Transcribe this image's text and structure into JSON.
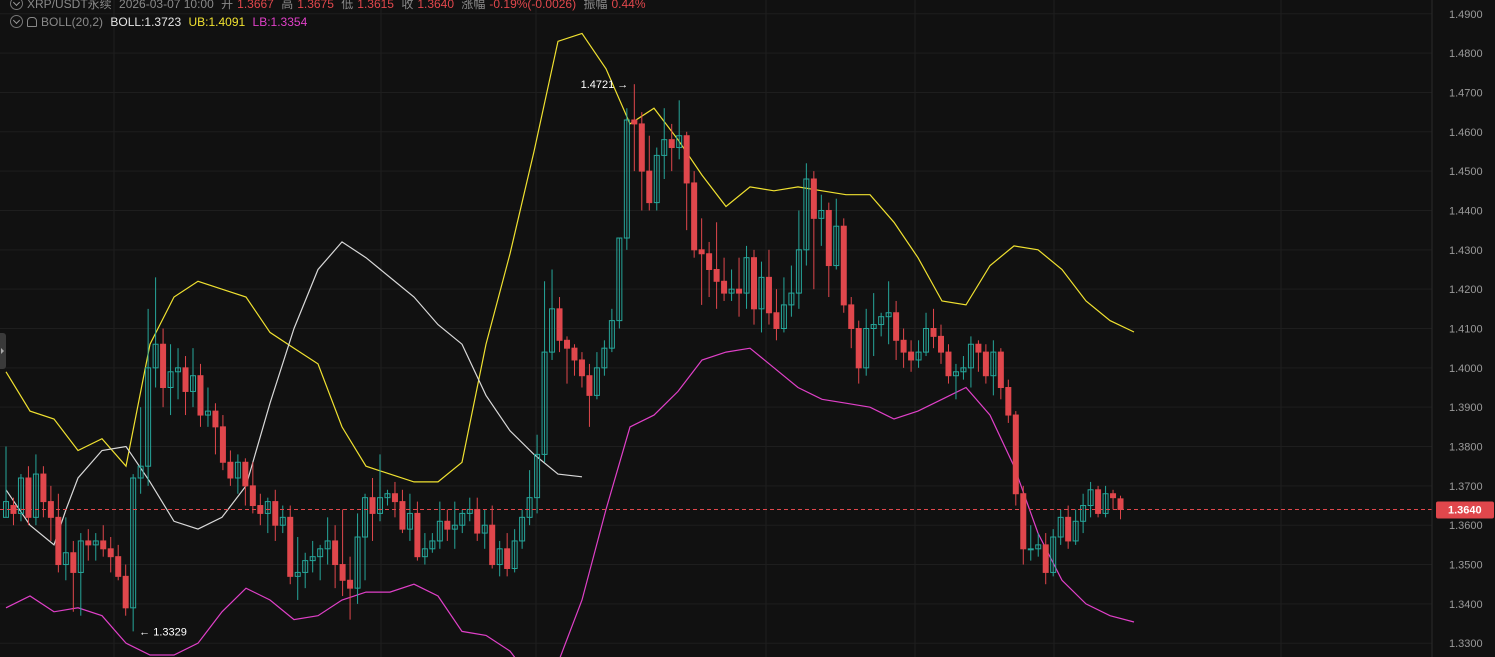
{
  "header": {
    "symbol": "XRP/USDT永续",
    "datetime": "2026-03-07 10:00",
    "open_label": "开",
    "open": "1.3667",
    "high_label": "高",
    "high": "1.3675",
    "low_label": "低",
    "low": "1.3615",
    "close_label": "收",
    "close": "1.3640",
    "change_label": "涨幅",
    "change": "-0.19%(-0.0026)",
    "amplitude_label": "振幅",
    "amplitude": "0.44%"
  },
  "indicator": {
    "name": "BOLL(20,2)",
    "boll": "BOLL:1.3723",
    "ub": "UB:1.4091",
    "lb": "LB:1.3354"
  },
  "colors": {
    "background": "#111111",
    "up": "#26a69a",
    "down": "#e0474c",
    "mid_band": "#d9d9d9",
    "upper_band": "#f0e130",
    "lower_band": "#e040c8",
    "grid": "#1e1e1e"
  },
  "chart_data": {
    "type": "candlestick",
    "y_range": [
      1.3265,
      1.4935
    ],
    "y_ticks": [
      "1.3300",
      "1.3400",
      "1.3500",
      "1.3600",
      "1.3700",
      "1.3800",
      "1.3900",
      "1.4000",
      "1.4100",
      "1.4200",
      "1.4300",
      "1.4400",
      "1.4500",
      "1.4600",
      "1.4700",
      "1.4800",
      "1.4900"
    ],
    "last_price": "1.3640",
    "max_label": "1.4721",
    "min_label": "1.3329",
    "candles": [
      [
        1.362,
        1.366,
        1.38,
        1.362
      ],
      [
        1.365,
        1.363,
        1.367,
        1.36
      ],
      [
        1.363,
        1.372,
        1.373,
        1.361
      ],
      [
        1.372,
        1.362,
        1.375,
        1.36
      ],
      [
        1.362,
        1.373,
        1.378,
        1.36
      ],
      [
        1.373,
        1.366,
        1.375,
        1.362
      ],
      [
        1.366,
        1.362,
        1.37,
        1.356
      ],
      [
        1.362,
        1.35,
        1.368,
        1.348
      ],
      [
        1.35,
        1.353,
        1.362,
        1.346
      ],
      [
        1.353,
        1.348,
        1.356,
        1.338
      ],
      [
        1.348,
        1.356,
        1.358,
        1.337
      ],
      [
        1.356,
        1.355,
        1.359,
        1.351
      ],
      [
        1.355,
        1.356,
        1.358,
        1.351
      ],
      [
        1.356,
        1.354,
        1.36,
        1.352
      ],
      [
        1.354,
        1.352,
        1.357,
        1.348
      ],
      [
        1.352,
        1.347,
        1.355,
        1.346
      ],
      [
        1.347,
        1.339,
        1.35,
        1.337
      ],
      [
        1.339,
        1.372,
        1.373,
        1.333
      ],
      [
        1.372,
        1.375,
        1.39,
        1.368
      ],
      [
        1.375,
        1.4,
        1.415,
        1.37
      ],
      [
        1.4,
        1.406,
        1.423,
        1.395
      ],
      [
        1.406,
        1.395,
        1.41,
        1.39
      ],
      [
        1.395,
        1.399,
        1.406,
        1.388
      ],
      [
        1.399,
        1.4,
        1.405,
        1.392
      ],
      [
        1.4,
        1.394,
        1.403,
        1.388
      ],
      [
        1.394,
        1.398,
        1.405,
        1.39
      ],
      [
        1.398,
        1.388,
        1.401,
        1.385
      ],
      [
        1.388,
        1.389,
        1.395,
        1.385
      ],
      [
        1.389,
        1.385,
        1.391,
        1.378
      ],
      [
        1.385,
        1.376,
        1.388,
        1.374
      ],
      [
        1.376,
        1.372,
        1.379,
        1.37
      ],
      [
        1.372,
        1.376,
        1.378,
        1.368
      ],
      [
        1.376,
        1.37,
        1.377,
        1.365
      ],
      [
        1.37,
        1.365,
        1.376,
        1.363
      ],
      [
        1.365,
        1.363,
        1.368,
        1.36
      ],
      [
        1.363,
        1.366,
        1.367,
        1.358
      ],
      [
        1.366,
        1.36,
        1.369,
        1.356
      ],
      [
        1.36,
        1.362,
        1.365,
        1.358
      ],
      [
        1.362,
        1.347,
        1.365,
        1.345
      ],
      [
        1.347,
        1.348,
        1.357,
        1.341
      ],
      [
        1.348,
        1.351,
        1.353,
        1.344
      ],
      [
        1.351,
        1.352,
        1.356,
        1.348
      ],
      [
        1.352,
        1.354,
        1.355,
        1.346
      ],
      [
        1.354,
        1.356,
        1.362,
        1.35
      ],
      [
        1.356,
        1.35,
        1.36,
        1.344
      ],
      [
        1.35,
        1.346,
        1.364,
        1.342
      ],
      [
        1.346,
        1.344,
        1.352,
        1.336
      ],
      [
        1.344,
        1.357,
        1.363,
        1.34
      ],
      [
        1.357,
        1.367,
        1.368,
        1.346
      ],
      [
        1.367,
        1.363,
        1.372,
        1.356
      ],
      [
        1.363,
        1.367,
        1.378,
        1.361
      ],
      [
        1.367,
        1.368,
        1.369,
        1.365
      ],
      [
        1.368,
        1.366,
        1.371,
        1.362
      ],
      [
        1.366,
        1.359,
        1.369,
        1.358
      ],
      [
        1.359,
        1.363,
        1.368,
        1.356
      ],
      [
        1.363,
        1.352,
        1.366,
        1.351
      ],
      [
        1.352,
        1.354,
        1.358,
        1.35
      ],
      [
        1.354,
        1.356,
        1.358,
        1.353
      ],
      [
        1.356,
        1.361,
        1.366,
        1.354
      ],
      [
        1.361,
        1.359,
        1.364,
        1.356
      ],
      [
        1.359,
        1.36,
        1.366,
        1.354
      ],
      [
        1.36,
        1.363,
        1.364,
        1.358
      ],
      [
        1.363,
        1.364,
        1.367,
        1.361
      ],
      [
        1.364,
        1.358,
        1.367,
        1.356
      ],
      [
        1.358,
        1.36,
        1.364,
        1.354
      ],
      [
        1.36,
        1.35,
        1.365,
        1.349
      ],
      [
        1.35,
        1.354,
        1.356,
        1.347
      ],
      [
        1.354,
        1.349,
        1.358,
        1.347
      ],
      [
        1.349,
        1.356,
        1.359,
        1.348
      ],
      [
        1.356,
        1.362,
        1.364,
        1.354
      ],
      [
        1.362,
        1.367,
        1.374,
        1.36
      ],
      [
        1.367,
        1.378,
        1.383,
        1.363
      ],
      [
        1.378,
        1.404,
        1.422,
        1.376
      ],
      [
        1.404,
        1.415,
        1.425,
        1.402
      ],
      [
        1.415,
        1.407,
        1.418,
        1.404
      ],
      [
        1.407,
        1.405,
        1.408,
        1.396
      ],
      [
        1.405,
        1.402,
        1.406,
        1.398
      ],
      [
        1.402,
        1.398,
        1.404,
        1.395
      ],
      [
        1.398,
        1.393,
        1.401,
        1.385
      ],
      [
        1.393,
        1.4,
        1.404,
        1.392
      ],
      [
        1.4,
        1.405,
        1.407,
        1.398
      ],
      [
        1.405,
        1.412,
        1.415,
        1.404
      ],
      [
        1.412,
        1.433,
        1.433,
        1.41
      ],
      [
        1.433,
        1.463,
        1.466,
        1.43
      ],
      [
        1.463,
        1.462,
        1.4721,
        1.45
      ],
      [
        1.462,
        1.45,
        1.465,
        1.44
      ],
      [
        1.45,
        1.442,
        1.459,
        1.44
      ],
      [
        1.442,
        1.454,
        1.456,
        1.44
      ],
      [
        1.454,
        1.458,
        1.466,
        1.448
      ],
      [
        1.458,
        1.456,
        1.462,
        1.45
      ],
      [
        1.456,
        1.459,
        1.468,
        1.453
      ],
      [
        1.459,
        1.447,
        1.46,
        1.435
      ],
      [
        1.447,
        1.43,
        1.45,
        1.428
      ],
      [
        1.43,
        1.429,
        1.438,
        1.416
      ],
      [
        1.429,
        1.425,
        1.432,
        1.418
      ],
      [
        1.425,
        1.422,
        1.437,
        1.415
      ],
      [
        1.422,
        1.419,
        1.428,
        1.417
      ],
      [
        1.419,
        1.42,
        1.425,
        1.417
      ],
      [
        1.42,
        1.419,
        1.428,
        1.413
      ],
      [
        1.419,
        1.428,
        1.431,
        1.415
      ],
      [
        1.428,
        1.415,
        1.43,
        1.411
      ],
      [
        1.415,
        1.423,
        1.427,
        1.409
      ],
      [
        1.423,
        1.414,
        1.43,
        1.411
      ],
      [
        1.414,
        1.41,
        1.42,
        1.407
      ],
      [
        1.41,
        1.416,
        1.423,
        1.409
      ],
      [
        1.416,
        1.419,
        1.426,
        1.413
      ],
      [
        1.419,
        1.43,
        1.44,
        1.415
      ],
      [
        1.43,
        1.448,
        1.452,
        1.426
      ],
      [
        1.448,
        1.438,
        1.45,
        1.42
      ],
      [
        1.438,
        1.44,
        1.444,
        1.431
      ],
      [
        1.44,
        1.426,
        1.442,
        1.418
      ],
      [
        1.426,
        1.436,
        1.443,
        1.425
      ],
      [
        1.436,
        1.416,
        1.438,
        1.414
      ],
      [
        1.416,
        1.41,
        1.418,
        1.405
      ],
      [
        1.41,
        1.4,
        1.412,
        1.396
      ],
      [
        1.4,
        1.41,
        1.415,
        1.398
      ],
      [
        1.41,
        1.411,
        1.419,
        1.403
      ],
      [
        1.411,
        1.413,
        1.414,
        1.408
      ],
      [
        1.413,
        1.414,
        1.422,
        1.406
      ],
      [
        1.414,
        1.407,
        1.417,
        1.402
      ],
      [
        1.407,
        1.404,
        1.41,
        1.4
      ],
      [
        1.404,
        1.402,
        1.407,
        1.399
      ],
      [
        1.402,
        1.404,
        1.407,
        1.4
      ],
      [
        1.404,
        1.41,
        1.414,
        1.403
      ],
      [
        1.41,
        1.408,
        1.415,
        1.405
      ],
      [
        1.408,
        1.404,
        1.411,
        1.401
      ],
      [
        1.404,
        1.398,
        1.406,
        1.396
      ],
      [
        1.398,
        1.399,
        1.401,
        1.392
      ],
      [
        1.399,
        1.4,
        1.403,
        1.397
      ],
      [
        1.4,
        1.406,
        1.408,
        1.395
      ],
      [
        1.406,
        1.404,
        1.407,
        1.399
      ],
      [
        1.404,
        1.398,
        1.406,
        1.396
      ],
      [
        1.398,
        1.404,
        1.407,
        1.393
      ],
      [
        1.404,
        1.395,
        1.405,
        1.392
      ],
      [
        1.395,
        1.388,
        1.397,
        1.386
      ],
      [
        1.388,
        1.368,
        1.389,
        1.365
      ],
      [
        1.368,
        1.354,
        1.37,
        1.35
      ],
      [
        1.354,
        1.354,
        1.36,
        1.351
      ],
      [
        1.354,
        1.355,
        1.358,
        1.352
      ],
      [
        1.355,
        1.348,
        1.358,
        1.345
      ],
      [
        1.348,
        1.357,
        1.359,
        1.347
      ],
      [
        1.357,
        1.362,
        1.364,
        1.355
      ],
      [
        1.362,
        1.356,
        1.365,
        1.354
      ],
      [
        1.356,
        1.361,
        1.364,
        1.355
      ],
      [
        1.361,
        1.365,
        1.368,
        1.358
      ],
      [
        1.365,
        1.369,
        1.371,
        1.362
      ],
      [
        1.369,
        1.363,
        1.37,
        1.362
      ],
      [
        1.363,
        1.368,
        1.37,
        1.362
      ],
      [
        1.368,
        1.367,
        1.369,
        1.364
      ],
      [
        1.3667,
        1.364,
        1.3675,
        1.3615
      ]
    ],
    "boll_mid": [
      [
        0,
        1.369
      ],
      [
        12,
        1.36
      ],
      [
        24,
        1.355
      ],
      [
        30,
        1.364
      ],
      [
        36,
        1.372
      ],
      [
        48,
        1.379
      ],
      [
        60,
        1.38
      ],
      [
        72,
        1.371
      ],
      [
        84,
        1.361
      ],
      [
        96,
        1.359
      ],
      [
        108,
        1.362
      ],
      [
        120,
        1.37
      ],
      [
        132,
        1.391
      ],
      [
        144,
        1.41
      ],
      [
        156,
        1.425
      ],
      [
        168,
        1.432
      ],
      [
        180,
        1.428
      ],
      [
        192,
        1.423
      ],
      [
        204,
        1.418
      ],
      [
        216,
        1.411
      ],
      [
        228,
        1.406
      ],
      [
        240,
        1.393
      ],
      [
        252,
        1.384
      ],
      [
        264,
        1.378
      ],
      [
        276,
        1.373
      ],
      [
        288,
        1.3723
      ]
    ],
    "boll_upper": [
      [
        0,
        1.399
      ],
      [
        12,
        1.389
      ],
      [
        24,
        1.387
      ],
      [
        36,
        1.379
      ],
      [
        48,
        1.382
      ],
      [
        60,
        1.375
      ],
      [
        72,
        1.406
      ],
      [
        84,
        1.418
      ],
      [
        96,
        1.422
      ],
      [
        108,
        1.42
      ],
      [
        120,
        1.418
      ],
      [
        132,
        1.409
      ],
      [
        144,
        1.405
      ],
      [
        156,
        1.401
      ],
      [
        168,
        1.385
      ],
      [
        180,
        1.375
      ],
      [
        192,
        1.373
      ],
      [
        204,
        1.371
      ],
      [
        216,
        1.371
      ],
      [
        228,
        1.376
      ],
      [
        240,
        1.406
      ],
      [
        252,
        1.429
      ],
      [
        264,
        1.455
      ],
      [
        276,
        1.483
      ],
      [
        288,
        1.485
      ],
      [
        300,
        1.476
      ],
      [
        312,
        1.462
      ],
      [
        324,
        1.466
      ],
      [
        336,
        1.458
      ],
      [
        348,
        1.449
      ],
      [
        360,
        1.441
      ],
      [
        372,
        1.446
      ],
      [
        384,
        1.445
      ],
      [
        396,
        1.446
      ],
      [
        408,
        1.445
      ],
      [
        420,
        1.444
      ],
      [
        432,
        1.444
      ],
      [
        444,
        1.437
      ],
      [
        456,
        1.428
      ],
      [
        468,
        1.417
      ],
      [
        480,
        1.416
      ],
      [
        492,
        1.426
      ],
      [
        504,
        1.431
      ],
      [
        516,
        1.43
      ],
      [
        528,
        1.425
      ],
      [
        540,
        1.417
      ],
      [
        552,
        1.412
      ],
      [
        564,
        1.4091
      ]
    ],
    "boll_lower": [
      [
        0,
        1.339
      ],
      [
        12,
        1.342
      ],
      [
        24,
        1.338
      ],
      [
        36,
        1.339
      ],
      [
        48,
        1.337
      ],
      [
        60,
        1.33
      ],
      [
        72,
        1.327
      ],
      [
        84,
        1.327
      ],
      [
        96,
        1.33
      ],
      [
        108,
        1.338
      ],
      [
        120,
        1.344
      ],
      [
        132,
        1.341
      ],
      [
        144,
        1.336
      ],
      [
        156,
        1.337
      ],
      [
        168,
        1.341
      ],
      [
        180,
        1.343
      ],
      [
        192,
        1.343
      ],
      [
        204,
        1.345
      ],
      [
        216,
        1.342
      ],
      [
        228,
        1.333
      ],
      [
        240,
        1.332
      ],
      [
        252,
        1.328
      ],
      [
        264,
        1.32
      ],
      [
        276,
        1.325
      ],
      [
        288,
        1.341
      ],
      [
        300,
        1.364
      ],
      [
        312,
        1.385
      ],
      [
        324,
        1.388
      ],
      [
        336,
        1.394
      ],
      [
        348,
        1.402
      ],
      [
        360,
        1.404
      ],
      [
        372,
        1.405
      ],
      [
        384,
        1.4
      ],
      [
        396,
        1.395
      ],
      [
        408,
        1.392
      ],
      [
        420,
        1.391
      ],
      [
        432,
        1.39
      ],
      [
        444,
        1.387
      ],
      [
        456,
        1.389
      ],
      [
        468,
        1.392
      ],
      [
        480,
        1.395
      ],
      [
        492,
        1.388
      ],
      [
        504,
        1.375
      ],
      [
        516,
        1.358
      ],
      [
        528,
        1.346
      ],
      [
        540,
        1.34
      ],
      [
        552,
        1.337
      ],
      [
        564,
        1.3354
      ]
    ]
  }
}
